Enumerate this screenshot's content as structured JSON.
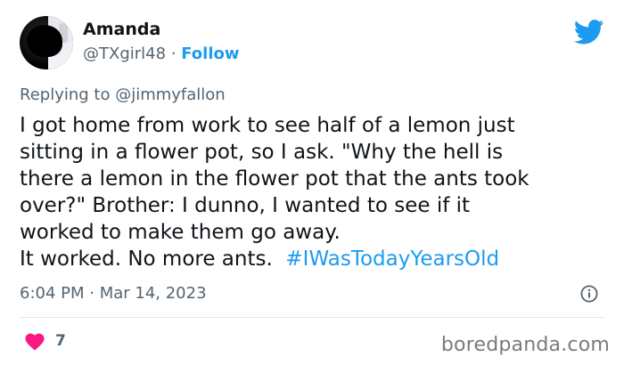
{
  "author": {
    "display_name": "Amanda",
    "handle": "@TXgirl48",
    "separator": " · ",
    "follow_label": "Follow"
  },
  "reply": {
    "prefix": "Replying to ",
    "mention": "@jimmyfallon"
  },
  "tweet": {
    "lines": [
      "I got home from work to see half of a lemon just",
      "sitting in a flower pot, so I ask. \"Why the hell is",
      "there a lemon in the flower pot that the ants took",
      "over?\" Brother: I dunno, I wanted to see if it",
      "worked to make them go away."
    ],
    "last_line_text": "It worked. No more ants.  ",
    "hashtag": "#IWasTodayYearsOld"
  },
  "meta": {
    "timestamp": "6:04 PM · Mar 14, 2023"
  },
  "engagement": {
    "like_count": "7"
  },
  "watermark": "boredpanda.com",
  "colors": {
    "accent": "#1d9bf0",
    "heart": "#f91880",
    "text": "#0f1419",
    "muted": "#536471"
  },
  "icons": {
    "brand": "twitter-bird-icon",
    "info": "info-icon",
    "like": "heart-icon"
  }
}
